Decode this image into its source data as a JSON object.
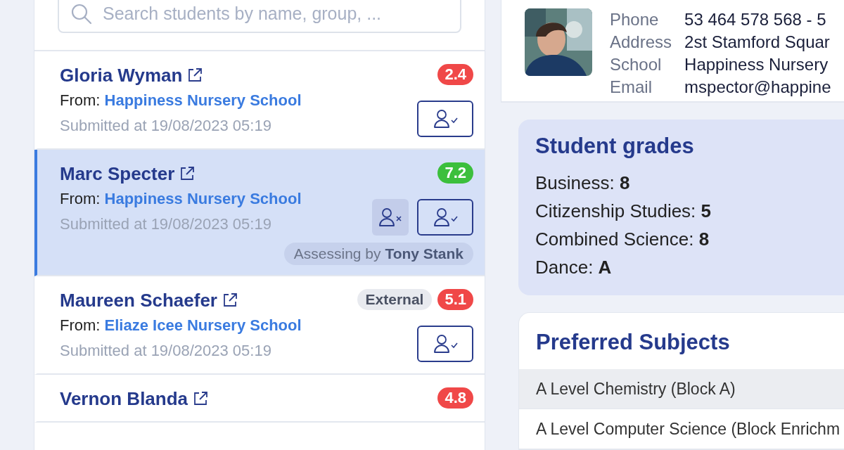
{
  "search": {
    "placeholder": "Search students by name, group, ..."
  },
  "students": [
    {
      "name": "Gloria Wyman",
      "from_label": "From:",
      "school": "Happiness Nursery School",
      "submitted": "Submitted at 19/08/2023 05:19",
      "score": "2.4",
      "color": "#f04848",
      "selected": false,
      "actions": [
        {
          "kind": "accept"
        }
      ]
    },
    {
      "name": "Marc Specter",
      "from_label": "From:",
      "school": "Happiness Nursery School",
      "submitted": "Submitted at 19/08/2023 05:19",
      "score": "7.2",
      "color": "#3cbf3c",
      "selected": true,
      "actions": [
        {
          "kind": "reject"
        },
        {
          "kind": "accept"
        }
      ],
      "assessing": "Assessing by **Tony Stank**"
    },
    {
      "name": "Maureen Schaefer",
      "from_label": "From:",
      "school": "Eliaze Icee Nursery School",
      "submitted": "Submitted at 19/08/2023 05:19",
      "score": "5.1",
      "color": "#f04848",
      "selected": false,
      "tag": "External",
      "actions": [
        {
          "kind": "accept"
        }
      ]
    },
    {
      "name": "Vernon Blanda",
      "score": "4.8",
      "color": "#f04848",
      "selected": false
    }
  ],
  "profile": {
    "fields": [
      {
        "label": "Phone",
        "value": "53 464 578 568 - 5"
      },
      {
        "label": "Address",
        "value": "2st Stamford Squar"
      },
      {
        "label": "School",
        "value": "Happiness Nursery"
      },
      {
        "label": "Email",
        "value": "mspector@happine"
      }
    ]
  },
  "grades": {
    "title": "Student grades",
    "items": [
      "Business: **8**",
      "Citizenship Studies: **5**",
      "Combined Science: **8**",
      "Dance: **A**"
    ]
  },
  "subjects": {
    "title": "Preferred Subjects",
    "rows": [
      {
        "name": "A Level Chemistry (Block A)",
        "selected": true
      },
      {
        "name": "A Level Computer Science (Block Enrichm",
        "selected": false
      }
    ]
  }
}
